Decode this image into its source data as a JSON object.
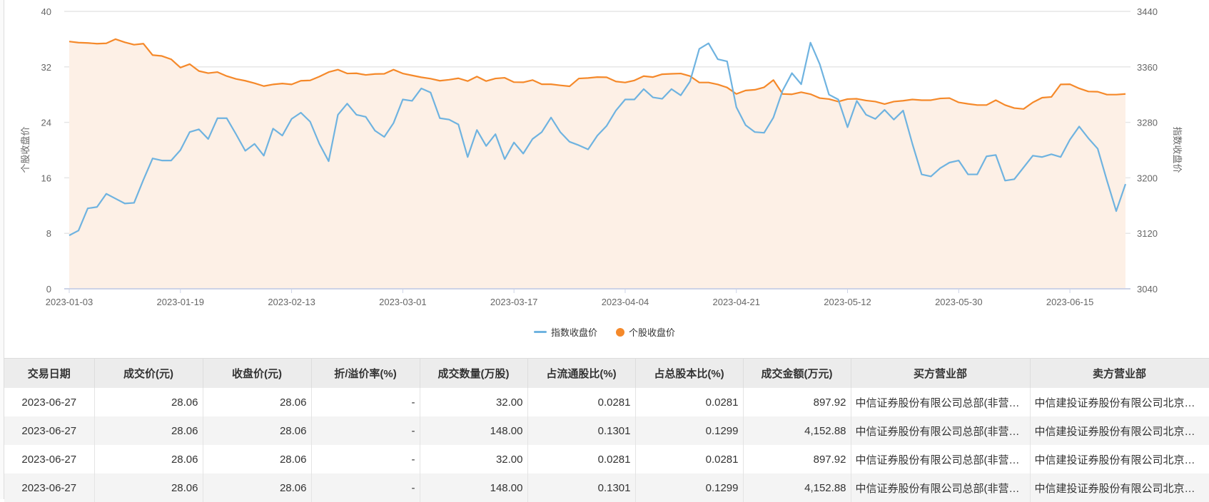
{
  "chart_data": {
    "type": "line",
    "x_tick_labels": [
      "2023-01-03",
      "2023-01-19",
      "2023-02-13",
      "2023-03-01",
      "2023-03-17",
      "2023-04-04",
      "2023-04-21",
      "2023-05-12",
      "2023-05-30",
      "2023-06-15"
    ],
    "x_tick_every": 12,
    "left_axis": {
      "label": "个股收盘价",
      "range": [
        0,
        40
      ],
      "ticks": [
        "0",
        "8",
        "16",
        "24",
        "32",
        "40"
      ]
    },
    "right_axis": {
      "label": "指数收盘价",
      "range": [
        3040,
        3440
      ],
      "ticks": [
        "3040",
        "3120",
        "3200",
        "3280",
        "3360",
        "3440"
      ]
    },
    "grid": true,
    "legend_position": "bottom-center",
    "series": [
      {
        "name": "指数收盘价",
        "axis": "right",
        "color": "#6fb3e0",
        "values": [
          3117,
          3124,
          3156,
          3158,
          3177,
          3170,
          3163,
          3164,
          3197,
          3228,
          3225,
          3225,
          3240,
          3266,
          3270,
          3256,
          3286,
          3286,
          3263,
          3239,
          3249,
          3232,
          3271,
          3261,
          3285,
          3294,
          3281,
          3249,
          3224,
          3291,
          3307,
          3291,
          3288,
          3268,
          3259,
          3279,
          3313,
          3311,
          3329,
          3323,
          3286,
          3284,
          3277,
          3230,
          3269,
          3246,
          3263,
          3227,
          3251,
          3235,
          3256,
          3266,
          3287,
          3266,
          3252,
          3247,
          3241,
          3261,
          3275,
          3297,
          3313,
          3313,
          3328,
          3316,
          3314,
          3328,
          3319,
          3339,
          3386,
          3394,
          3371,
          3368,
          3302,
          3276,
          3266,
          3265,
          3287,
          3326,
          3351,
          3335,
          3395,
          3364,
          3320,
          3313,
          3273,
          3311,
          3291,
          3285,
          3298,
          3284,
          3297,
          3249,
          3205,
          3202,
          3214,
          3222,
          3225,
          3205,
          3205,
          3231,
          3233,
          3196,
          3198,
          3215,
          3232,
          3230,
          3234,
          3230,
          3255,
          3274,
          3257,
          3242,
          3196,
          3152,
          3191
        ]
      },
      {
        "name": "个股收盘价",
        "axis": "left",
        "color": "#f5892a",
        "fill": "#fdf0e6",
        "values": [
          35.66,
          35.5,
          35.45,
          35.35,
          35.4,
          36.0,
          35.55,
          35.2,
          35.35,
          33.7,
          33.57,
          33.1,
          31.9,
          32.4,
          31.4,
          31.1,
          31.25,
          30.67,
          30.26,
          30.0,
          29.65,
          29.23,
          29.47,
          29.6,
          29.47,
          30.0,
          30.05,
          30.6,
          31.25,
          31.6,
          31.05,
          31.08,
          30.84,
          30.98,
          31.0,
          31.6,
          31.05,
          30.77,
          30.5,
          30.3,
          30.0,
          30.15,
          30.36,
          29.95,
          30.6,
          29.95,
          30.33,
          30.43,
          29.8,
          29.78,
          30.1,
          29.5,
          29.5,
          29.34,
          29.2,
          30.33,
          30.4,
          30.53,
          30.5,
          29.9,
          29.75,
          30.05,
          30.67,
          30.53,
          30.94,
          31.0,
          31.05,
          30.67,
          29.75,
          29.75,
          29.47,
          29.03,
          28.1,
          28.6,
          28.7,
          29.06,
          30.1,
          28.1,
          28.05,
          28.35,
          28.07,
          27.5,
          27.36,
          27.0,
          27.36,
          27.4,
          27.15,
          27.0,
          26.64,
          27.0,
          27.12,
          27.3,
          27.2,
          27.2,
          27.45,
          27.5,
          26.88,
          26.67,
          26.5,
          26.5,
          27.2,
          26.5,
          26.06,
          25.93,
          26.88,
          27.56,
          27.67,
          29.47,
          29.5,
          28.9,
          28.45,
          28.42,
          28.0,
          28.0,
          28.1
        ]
      }
    ]
  },
  "legend": {
    "index_label": "指数收盘价",
    "stock_label": "个股收盘价"
  },
  "table": {
    "headers": [
      "交易日期",
      "成交价(元)",
      "收盘价(元)",
      "折/溢价率(%)",
      "成交数量(万股)",
      "占流通股比(%)",
      "占总股本比(%)",
      "成交金额(万元)",
      "买方营业部",
      "卖方营业部"
    ],
    "rows": [
      [
        "2023-06-27",
        "28.06",
        "28.06",
        "-",
        "32.00",
        "0.0281",
        "0.0281",
        "897.92",
        "中信证券股份有限公司总部(非营业场所)",
        "中信建投证券股份有限公司北京分公司"
      ],
      [
        "2023-06-27",
        "28.06",
        "28.06",
        "-",
        "148.00",
        "0.1301",
        "0.1299",
        "4,152.88",
        "中信证券股份有限公司总部(非营业场所)",
        "中信建投证券股份有限公司北京分公司"
      ],
      [
        "2023-06-27",
        "28.06",
        "28.06",
        "-",
        "32.00",
        "0.0281",
        "0.0281",
        "897.92",
        "中信证券股份有限公司总部(非营业场所)",
        "中信建投证券股份有限公司北京分公司"
      ],
      [
        "2023-06-27",
        "28.06",
        "28.06",
        "-",
        "148.00",
        "0.1301",
        "0.1299",
        "4,152.88",
        "中信证券股份有限公司总部(非营业场所)",
        "中信建投证券股份有限公司北京分公司"
      ]
    ]
  }
}
